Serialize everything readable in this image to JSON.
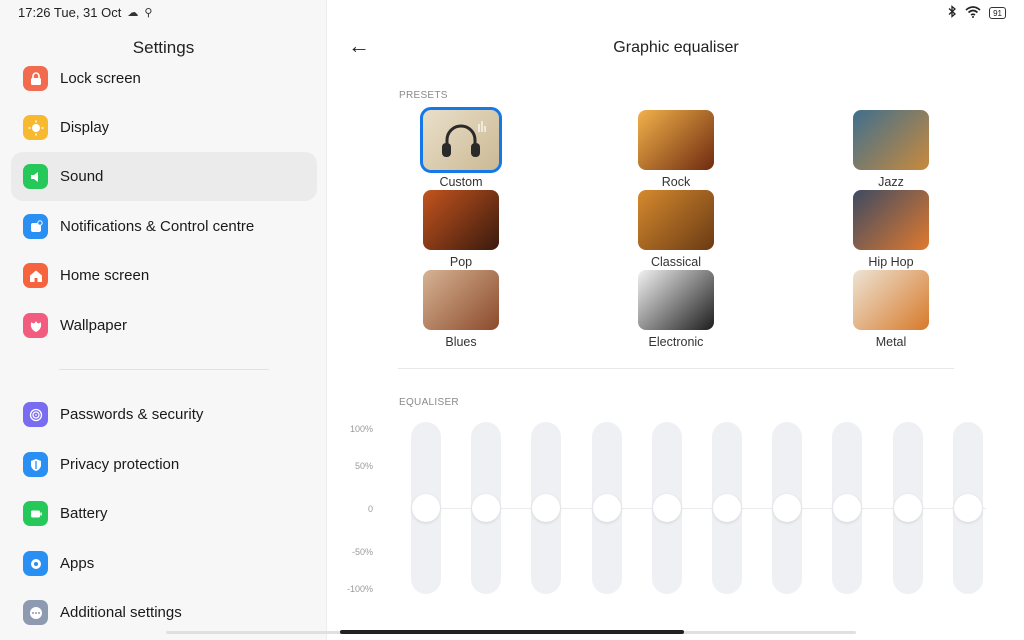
{
  "status": {
    "time": "17:26 Tue, 31 Oct",
    "battery": "91"
  },
  "settings": {
    "title": "Settings",
    "items": [
      {
        "label": "Lock screen",
        "color": "#f36b4f",
        "icon": "lock-icon"
      },
      {
        "label": "Display",
        "color": "#f7b930",
        "icon": "sun-icon"
      },
      {
        "label": "Sound",
        "color": "#26c85a",
        "icon": "speaker-icon"
      },
      {
        "label": "Notifications & Control centre",
        "color": "#2a8ff2",
        "icon": "notification-icon"
      },
      {
        "label": "Home screen",
        "color": "#f5643e",
        "icon": "home-icon"
      },
      {
        "label": "Wallpaper",
        "color": "#f15c7f",
        "icon": "flower-icon"
      },
      {
        "label": "Passwords & security",
        "color": "#7a6cf0",
        "icon": "fingerprint-icon"
      },
      {
        "label": "Privacy protection",
        "color": "#2a8ff2",
        "icon": "privacy-icon"
      },
      {
        "label": "Battery",
        "color": "#26c85a",
        "icon": "battery-icon"
      },
      {
        "label": "Apps",
        "color": "#2a8ff2",
        "icon": "gear-icon"
      },
      {
        "label": "Additional settings",
        "color": "#8e9ab0",
        "icon": "more-icon"
      }
    ]
  },
  "equaliser": {
    "title": "Graphic equaliser",
    "presets_label": "PRESETS",
    "eq_label": "EQUALISER",
    "presets": [
      {
        "label": "Custom",
        "selected": true,
        "c1": "#e9dfc9",
        "c2": "#cbb994"
      },
      {
        "label": "Rock",
        "selected": false,
        "c1": "#f2b24a",
        "c2": "#6e2a10"
      },
      {
        "label": "Jazz",
        "selected": false,
        "c1": "#3f6f8f",
        "c2": "#c98a3c"
      },
      {
        "label": "Pop",
        "selected": false,
        "c1": "#c3541e",
        "c2": "#3a1a0e"
      },
      {
        "label": "Classical",
        "selected": false,
        "c1": "#d58a2d",
        "c2": "#6a3a14"
      },
      {
        "label": "Hip Hop",
        "selected": false,
        "c1": "#3e4a63",
        "c2": "#e07a2e"
      },
      {
        "label": "Blues",
        "selected": false,
        "c1": "#d6b394",
        "c2": "#8b4a2b"
      },
      {
        "label": "Electronic",
        "selected": false,
        "c1": "#f2f2f2",
        "c2": "#1d1d1d"
      },
      {
        "label": "Metal",
        "selected": false,
        "c1": "#ede3d4",
        "c2": "#d77a2a"
      }
    ],
    "y_ticks": [
      "100%",
      "50%",
      "0",
      "-50%",
      "-100%"
    ],
    "bands": [
      0,
      0,
      0,
      0,
      0,
      0,
      0,
      0,
      0,
      0
    ],
    "accent": "#1677e6"
  }
}
